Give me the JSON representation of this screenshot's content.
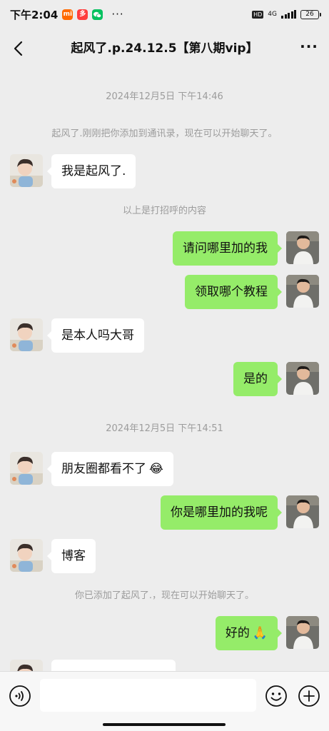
{
  "status_bar": {
    "time": "下午2:04",
    "network": "4G",
    "hd": "HD",
    "battery": "26",
    "more_dots": "···"
  },
  "header": {
    "title": "起风了.p.24.12.5【第八期vip】",
    "back_icon": "chevron-left-icon",
    "more_icon": "more-horizontal-icon",
    "more_label": "···"
  },
  "messages": [
    {
      "type": "time",
      "text": "2024年12月5日 下午14:46"
    },
    {
      "type": "system",
      "text": "起风了.刚刚把你添加到通讯录，现在可以开始聊天了。"
    },
    {
      "type": "in",
      "text": "我是起风了."
    },
    {
      "type": "system",
      "text": "以上是打招呼的内容"
    },
    {
      "type": "out",
      "text": "请问哪里加的我"
    },
    {
      "type": "out",
      "text": "领取哪个教程"
    },
    {
      "type": "in",
      "text": "是本人吗大哥"
    },
    {
      "type": "out",
      "text": "是的"
    },
    {
      "type": "time",
      "text": "2024年12月5日 下午14:51"
    },
    {
      "type": "in",
      "text": "朋友圈都看不了",
      "emoji": "😂"
    },
    {
      "type": "out",
      "text": "你是哪里加的我呢"
    },
    {
      "type": "in",
      "text": "博客"
    },
    {
      "type": "system",
      "text": "你已添加了起风了.，现在可以开始聊天了。"
    },
    {
      "type": "out",
      "text": "好的",
      "emoji": "🙏"
    }
  ],
  "input_bar": {
    "placeholder": "",
    "voice_icon": "voice-icon",
    "emoji_icon": "emoji-icon",
    "plus_icon": "plus-icon"
  },
  "colors": {
    "background": "#ededed",
    "outgoing_bubble": "#95ec69",
    "incoming_bubble": "#ffffff",
    "meta_text": "#9c9c9c"
  }
}
